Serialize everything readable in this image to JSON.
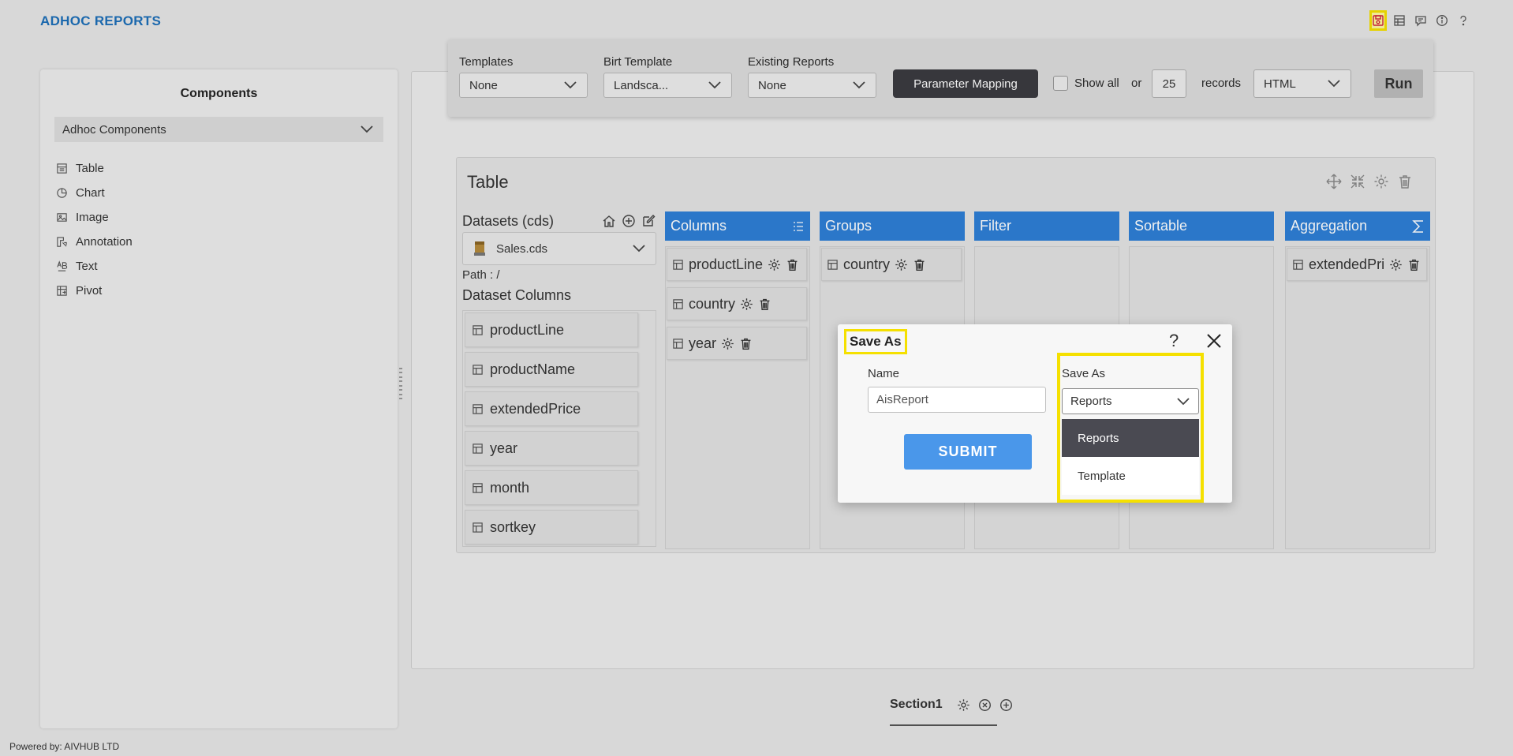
{
  "app": {
    "title": "ADHOC REPORTS"
  },
  "top_icons": [
    "save-icon",
    "table-view-icon",
    "comment-icon",
    "info-icon",
    "help-icon"
  ],
  "components": {
    "title": "Components",
    "selector": "Adhoc Components",
    "items": [
      {
        "label": "Table",
        "icon": "table-icon"
      },
      {
        "label": "Chart",
        "icon": "chart-icon"
      },
      {
        "label": "Image",
        "icon": "image-icon"
      },
      {
        "label": "Annotation",
        "icon": "annotation-icon"
      },
      {
        "label": "Text",
        "icon": "text-icon"
      },
      {
        "label": "Pivot",
        "icon": "pivot-icon"
      }
    ]
  },
  "toolbar": {
    "templates_label": "Templates",
    "templates_value": "None",
    "birt_label": "Birt Template",
    "birt_value": "Landsca...",
    "existing_label": "Existing Reports",
    "existing_value": "None",
    "param_mapping": "Parameter Mapping",
    "show_all": "Show all",
    "or": "or",
    "records_count": "25",
    "records": "records",
    "format": "HTML",
    "run": "Run"
  },
  "table_widget": {
    "title": "Table",
    "datasets_title": "Datasets (cds)",
    "dataset": "Sales.cds",
    "path": "Path : /",
    "dataset_columns_title": "Dataset Columns",
    "dataset_columns": [
      "productLine",
      "productName",
      "extendedPrice",
      "year",
      "month",
      "sortkey"
    ],
    "panels": {
      "columns": {
        "title": "Columns",
        "items": [
          "productLine",
          "country",
          "year"
        ]
      },
      "groups": {
        "title": "Groups",
        "items": [
          "country"
        ]
      },
      "filter": {
        "title": "Filter",
        "items": []
      },
      "sortable": {
        "title": "Sortable",
        "items": []
      },
      "aggregation": {
        "title": "Aggregation",
        "items": [
          "extendedPri"
        ]
      }
    }
  },
  "modal": {
    "title": "Save As",
    "help": "?",
    "name_label": "Name",
    "name_value": "AisReport",
    "submit": "SUBMIT",
    "saveas_label": "Save As",
    "saveas_value": "Reports",
    "options": [
      "Reports",
      "Template"
    ]
  },
  "section": {
    "name": "Section1"
  },
  "footer": {
    "powered": "Powered by: AIVHUB LTD"
  },
  "colors": {
    "accent": "#2e7fd6",
    "title_blue": "#1d6fb8",
    "highlight": "#f5e000",
    "dark_button": "#3b3b40"
  }
}
